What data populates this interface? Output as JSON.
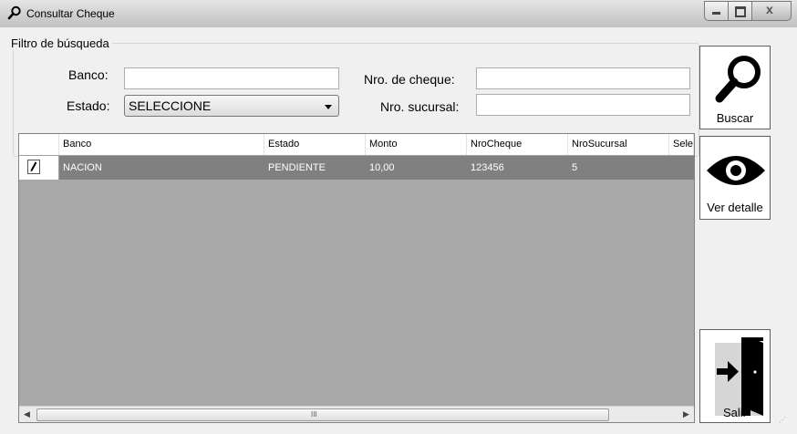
{
  "window": {
    "title": "Consultar Cheque",
    "title_icon": "search-icon"
  },
  "filter": {
    "group_title": "Filtro de búsqueda",
    "banco_label": "Banco:",
    "banco_value": "",
    "estado_label": "Estado:",
    "estado_value": "SELECCIONE",
    "nro_cheque_label": "Nro. de cheque:",
    "nro_cheque_value": "",
    "nro_sucursal_label": "Nro. sucursal:",
    "nro_sucursal_value": ""
  },
  "grid": {
    "columns": [
      "Banco",
      "Estado",
      "Monto",
      "NroCheque",
      "NroSucursal",
      "Sele"
    ],
    "rows": [
      {
        "banco": "NACION",
        "estado": "PENDIENTE",
        "monto": "10,00",
        "nro_cheque": "123456",
        "nro_sucursal": "5",
        "sele": ""
      }
    ],
    "selected_row_color": "#808080",
    "scroll_grip": "III"
  },
  "buttons": {
    "buscar": {
      "label": "Buscar",
      "icon": "magnifier-icon"
    },
    "ver_detalle": {
      "label": "Ver detalle",
      "icon": "eye-icon"
    },
    "salir": {
      "label": "Salir",
      "icon": "exit-door-icon"
    }
  },
  "colors": {
    "window_bg": "#f0f0f0",
    "grid_bg": "#a9a9a9"
  }
}
